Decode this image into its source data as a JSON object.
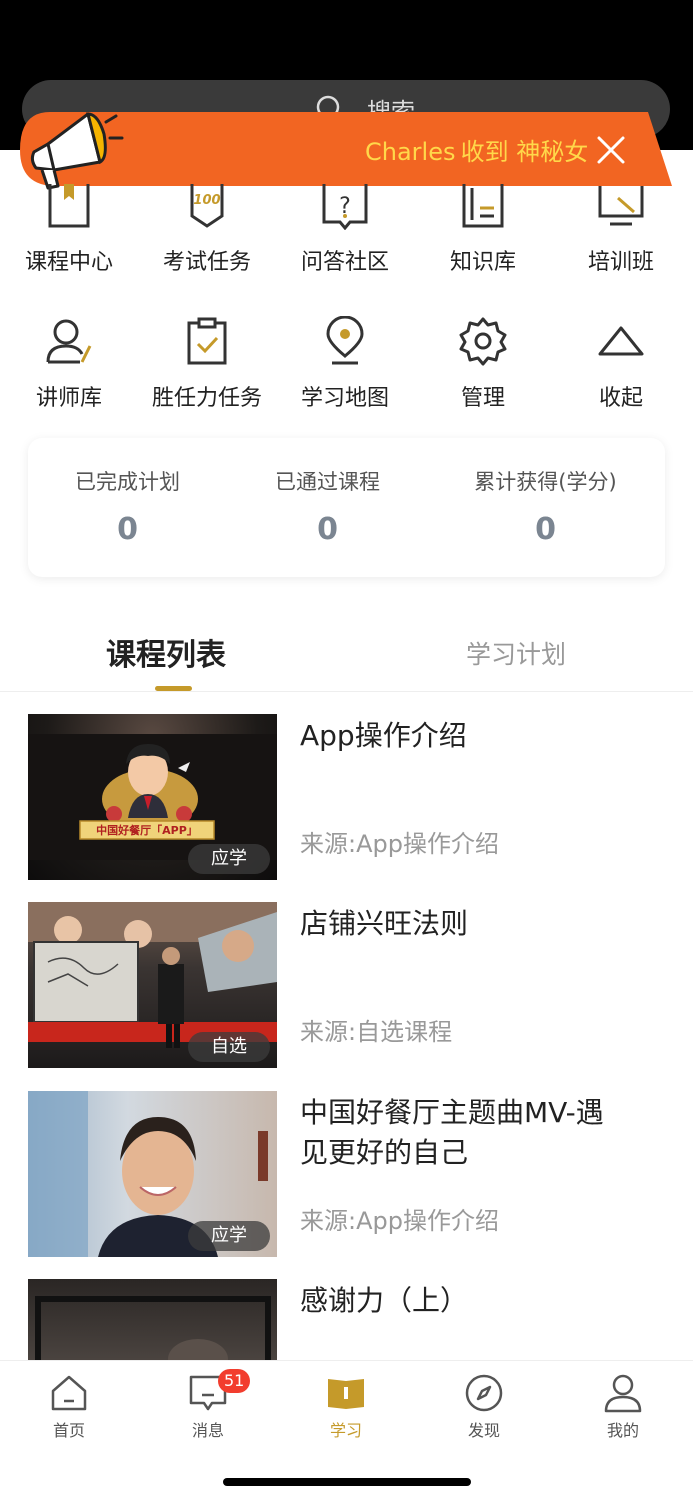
{
  "search": {
    "placeholder": "搜索"
  },
  "banner": {
    "name": "Charles",
    "text": "收到 神秘女"
  },
  "grid": [
    {
      "label": "课程中心",
      "icon": "book-icon"
    },
    {
      "label": "考试任务",
      "icon": "exam-100-icon"
    },
    {
      "label": "问答社区",
      "icon": "question-icon"
    },
    {
      "label": "知识库",
      "icon": "knowledge-doc-icon"
    },
    {
      "label": "培训班",
      "icon": "training-screen-icon"
    },
    {
      "label": "讲师库",
      "icon": "lecturer-icon"
    },
    {
      "label": "胜任力任务",
      "icon": "clipboard-check-icon"
    },
    {
      "label": "学习地图",
      "icon": "map-pin-icon"
    },
    {
      "label": "管理",
      "icon": "gear-icon"
    },
    {
      "label": "收起",
      "icon": "collapse-up-icon"
    }
  ],
  "stats": [
    {
      "label": "已完成计划",
      "value": "0"
    },
    {
      "label": "已通过课程",
      "value": "0"
    },
    {
      "label": "累计获得(学分)",
      "value": "0"
    }
  ],
  "tabs": {
    "active": "课程列表",
    "inactive": "学习计划"
  },
  "courses": [
    {
      "title": "App操作介绍",
      "source": "来源:App操作介绍",
      "badge": "应学",
      "thumb_text": "中国好餐厅「APP」"
    },
    {
      "title": "店铺兴旺法则",
      "source": "来源:自选课程",
      "badge": "自选"
    },
    {
      "title": "中国好餐厅主题曲MV-遇见更好的自己",
      "source": "来源:App操作介绍",
      "badge": "应学"
    },
    {
      "title": "感谢力（上）",
      "source": "",
      "badge": ""
    }
  ],
  "tabbar": [
    {
      "label": "首页",
      "icon": "home-icon"
    },
    {
      "label": "消息",
      "icon": "message-icon",
      "badge": "51"
    },
    {
      "label": "学习",
      "icon": "study-book-icon",
      "active": true
    },
    {
      "label": "发现",
      "icon": "compass-icon"
    },
    {
      "label": "我的",
      "icon": "profile-icon"
    }
  ],
  "colors": {
    "accent": "#c59a2a",
    "banner": "#f26522",
    "badge": "#f23d2e"
  }
}
